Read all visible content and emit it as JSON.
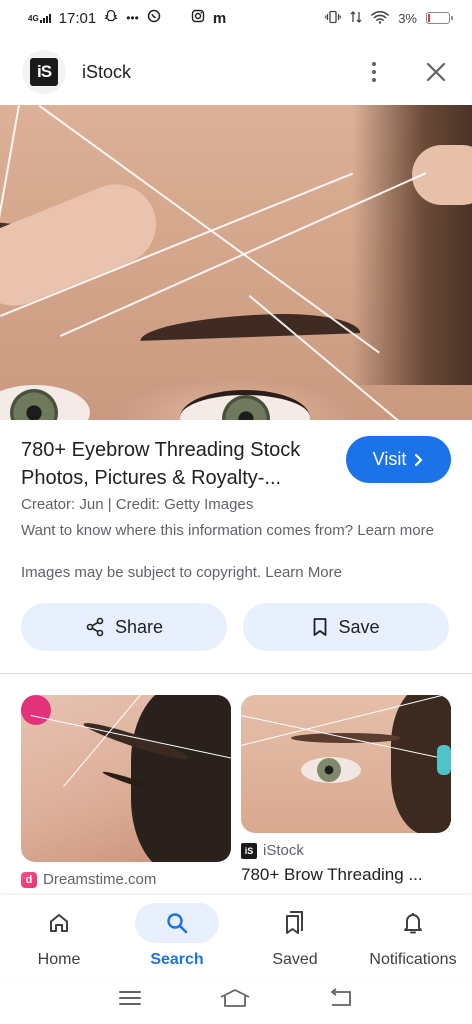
{
  "status_bar": {
    "network": "4G",
    "time": "17:01",
    "dots": "•••",
    "battery_percent": "3%",
    "icons": [
      "signal-icon",
      "snapchat-icon",
      "viber-icon",
      "instagram-icon",
      "m-icon",
      "vibrate-icon",
      "wifi-icon",
      "battery-icon"
    ]
  },
  "header": {
    "logo_text": "iS",
    "site_name": "iStock"
  },
  "result": {
    "title": "780+ Eyebrow Threading Stock Photos, Pictures & Royalty-...",
    "visit_label": "Visit",
    "creator_line": "Creator: Jun | Credit: Getty Images",
    "info_line": "Want to know where this information comes from? Learn more",
    "copyright_line": "Images may be subject to copyright. Learn More",
    "share_label": "Share",
    "save_label": "Save",
    "accent_color": "#1a73e8"
  },
  "related": [
    {
      "source": "Dreamstime.com",
      "icon": "dreamstime-icon"
    },
    {
      "source": "iStock",
      "title": "780+ Brow Threading ...",
      "icon": "istock-icon"
    }
  ],
  "bottom_nav": {
    "items": [
      {
        "label": "Home",
        "icon": "home-icon"
      },
      {
        "label": "Search",
        "icon": "search-icon",
        "active": true
      },
      {
        "label": "Saved",
        "icon": "bookmarks-icon"
      },
      {
        "label": "Notifications",
        "icon": "bell-icon"
      }
    ]
  }
}
